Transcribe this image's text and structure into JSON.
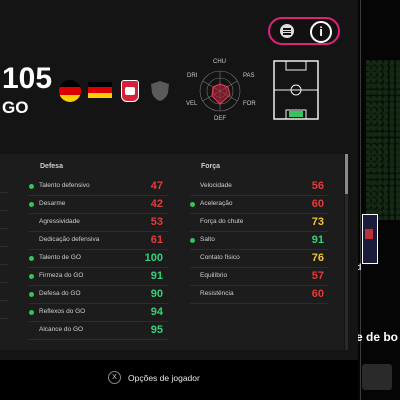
{
  "header": {
    "rating": "105",
    "position": "GO"
  },
  "radar": {
    "labels": [
      "CHU",
      "PAS",
      "FOR",
      "DEF",
      "VEL",
      "DRI"
    ]
  },
  "columns": {
    "defesa": "Defesa",
    "forca": "Força"
  },
  "defesa": [
    {
      "name": "Talento defensivo",
      "value": "47",
      "color": "#e23b3b",
      "dot": true
    },
    {
      "name": "Desarme",
      "value": "42",
      "color": "#e23b3b",
      "dot": true
    },
    {
      "name": "Agressividade",
      "value": "53",
      "color": "#e23b3b",
      "dot": false
    },
    {
      "name": "Dedicação defensiva",
      "value": "61",
      "color": "#e23b3b",
      "dot": false
    },
    {
      "name": "Talento de GO",
      "value": "100",
      "color": "#34d17a",
      "dot": true
    },
    {
      "name": "Firmeza do GO",
      "value": "91",
      "color": "#34d17a",
      "dot": true
    },
    {
      "name": "Defesa do GO",
      "value": "90",
      "color": "#34d17a",
      "dot": true
    },
    {
      "name": "Reflexos do GO",
      "value": "94",
      "color": "#34d17a",
      "dot": true
    },
    {
      "name": "Alcance do GO",
      "value": "95",
      "color": "#34d17a",
      "dot": false
    }
  ],
  "forca": [
    {
      "name": "Velocidade",
      "value": "56",
      "color": "#e23b3b",
      "dot": false
    },
    {
      "name": "Aceleração",
      "value": "60",
      "color": "#e23b3b",
      "dot": true
    },
    {
      "name": "Força do chute",
      "value": "73",
      "color": "#f0c43a",
      "dot": false
    },
    {
      "name": "Salto",
      "value": "91",
      "color": "#34d17a",
      "dot": true
    },
    {
      "name": "Contato físico",
      "value": "76",
      "color": "#f0c43a",
      "dot": false
    },
    {
      "name": "Equilíbrio",
      "value": "57",
      "color": "#e23b3b",
      "dot": false
    },
    {
      "name": "Resistência",
      "value": "60",
      "color": "#e23b3b",
      "dot": false
    }
  ],
  "footer": {
    "button_glyph": "X",
    "options_label": "Opções de jogador"
  },
  "right_panel": {
    "small_text": "d",
    "truncated_title": "e de bo"
  },
  "colors": {
    "accent": "#e0217a",
    "good": "#34d17a",
    "mid": "#f0c43a",
    "bad": "#e23b3b"
  }
}
